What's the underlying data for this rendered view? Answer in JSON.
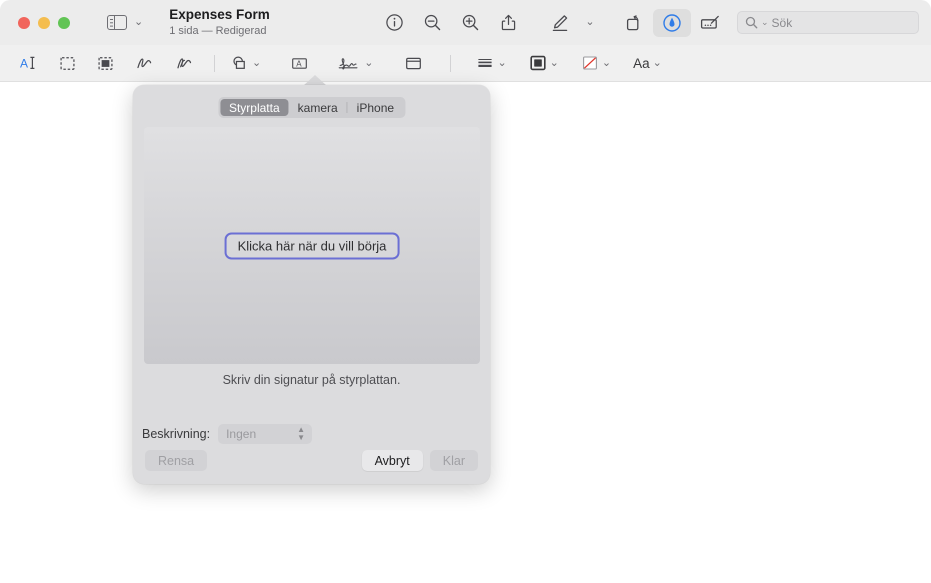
{
  "window": {
    "traffic_lights": [
      {
        "name": "close",
        "color": "#f1655c"
      },
      {
        "name": "minimize",
        "color": "#f4bd4f"
      },
      {
        "name": "zoom",
        "color": "#61c454"
      }
    ],
    "title": "Expenses Form",
    "subtitle": "1 sida — Redigerad",
    "sidebar_toggle_icon": "sidebar-icon",
    "sidebar_chevron": "⌄"
  },
  "toolbar": {
    "items": [
      {
        "name": "info-button",
        "icon": "info-icon",
        "label": "Info"
      },
      {
        "name": "zoom-out-button",
        "icon": "zoom-out-icon",
        "label": "Zooma ut"
      },
      {
        "name": "zoom-in-button",
        "icon": "zoom-in-icon",
        "label": "Zooma in"
      },
      {
        "name": "share-button",
        "icon": "share-icon",
        "label": "Dela"
      },
      {
        "name": "highlight-button",
        "icon": "highlighter-pen-icon",
        "label": "Markera"
      },
      {
        "name": "highlight-options-button",
        "icon": "chevron-down-icon",
        "label": ""
      },
      {
        "name": "rotate-button",
        "icon": "rotate-left-icon",
        "label": "Rotera"
      },
      {
        "name": "markup-button",
        "icon": "markup-pen-circle-icon",
        "label": "Markering",
        "active": true
      },
      {
        "name": "signature-toolbar-button",
        "icon": "signature-pad-icon",
        "label": "Signatur"
      }
    ]
  },
  "search": {
    "icon": "search-icon",
    "chevron": "⌄",
    "placeholder": "Sök",
    "value": ""
  },
  "markup_toolbar": {
    "items": [
      {
        "name": "text-selection-tool",
        "icon": "text-select-icon",
        "active": true
      },
      {
        "name": "rectangular-selection-tool",
        "icon": "rectangular-selection-icon"
      },
      {
        "name": "instant-alpha-tool",
        "icon": "instant-alpha-icon"
      },
      {
        "name": "sketch-tool",
        "icon": "sketch-icon"
      },
      {
        "name": "draw-tool",
        "icon": "draw-icon"
      },
      {
        "name": "shapes-tool",
        "icon": "shapes-icon",
        "chevron": "⌄"
      },
      {
        "name": "text-tool",
        "icon": "text-box-icon"
      },
      {
        "name": "signature-tool",
        "icon": "signature-icon",
        "chevron": "⌄"
      },
      {
        "name": "note-tool",
        "icon": "note-icon"
      },
      {
        "name": "line-style-tool",
        "icon": "line-thickness-icon",
        "chevron": "⌄"
      },
      {
        "name": "border-style-tool",
        "icon": "border-style-icon",
        "chevron": "⌄"
      },
      {
        "name": "fill-color-tool",
        "icon": "fill-none-icon",
        "chevron": "⌄"
      },
      {
        "name": "font-style-tool",
        "icon": "font-aa-icon",
        "label": "Aa",
        "chevron": "⌄"
      }
    ]
  },
  "signature_popover": {
    "tabs": [
      {
        "name": "tab-trackpad",
        "label": "Styrplatta",
        "selected": true
      },
      {
        "name": "tab-camera",
        "label": "kamera",
        "selected": false
      },
      {
        "name": "tab-iphone",
        "label": "iPhone",
        "selected": false
      }
    ],
    "pad": {
      "start_button_label": "Klicka här när du vill börja",
      "focus_ring_color": "#6b6fd4"
    },
    "hint_text": "Skriv din signatur på styrplattan.",
    "description": {
      "label": "Beskrivning:",
      "value": "Ingen",
      "enabled": false
    },
    "buttons": {
      "clear": {
        "label": "Rensa",
        "enabled": false
      },
      "cancel": {
        "label": "Avbryt",
        "enabled": true
      },
      "done": {
        "label": "Klar",
        "enabled": false
      }
    }
  }
}
